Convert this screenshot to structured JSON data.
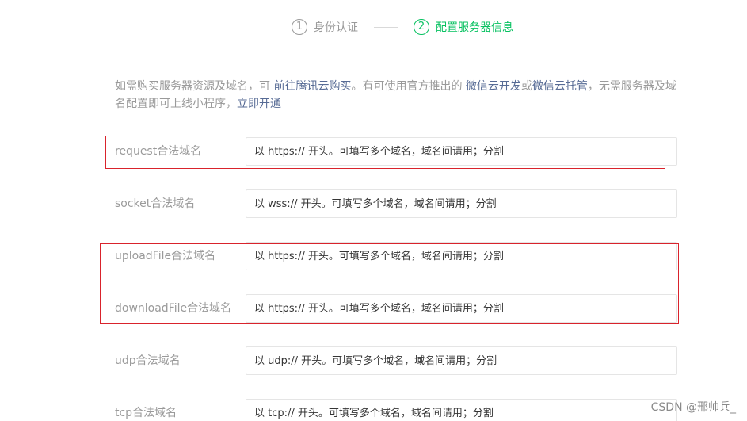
{
  "steps": [
    {
      "num": "1",
      "label": "身份认证",
      "active": false
    },
    {
      "num": "2",
      "label": "配置服务器信息",
      "active": true
    }
  ],
  "intro": {
    "part1": "如需购买服务器资源及域名，可 ",
    "link1": "前往腾讯云购买",
    "part2": "。有可使用官方推出的 ",
    "link2": "微信云开发",
    "part3": "或",
    "link3": "微信云托管",
    "part4": "，无需服务器及域名配置即可上线小程序，",
    "link4": "立即开通"
  },
  "form": {
    "request": {
      "label": "request合法域名",
      "placeholder": "以 https:// 开头。可填写多个域名，域名间请用；分割"
    },
    "socket": {
      "label": "socket合法域名",
      "placeholder": "以 wss:// 开头。可填写多个域名，域名间请用；分割"
    },
    "uploadFile": {
      "label": "uploadFile合法域名",
      "placeholder": "以 https:// 开头。可填写多个域名，域名间请用；分割"
    },
    "downloadFile": {
      "label": "downloadFile合法域名",
      "placeholder": "以 https:// 开头。可填写多个域名，域名间请用；分割"
    },
    "udp": {
      "label": "udp合法域名",
      "placeholder": "以 udp:// 开头。可填写多个域名，域名间请用；分割"
    },
    "tcp": {
      "label": "tcp合法域名",
      "placeholder": "以 tcp:// 开头。可填写多个域名，域名间请用；分割"
    }
  },
  "watermark": "CSDN @邢帅兵_",
  "colors": {
    "accent": "#07c160",
    "link": "#576b95",
    "annotation": "#d9232c"
  }
}
